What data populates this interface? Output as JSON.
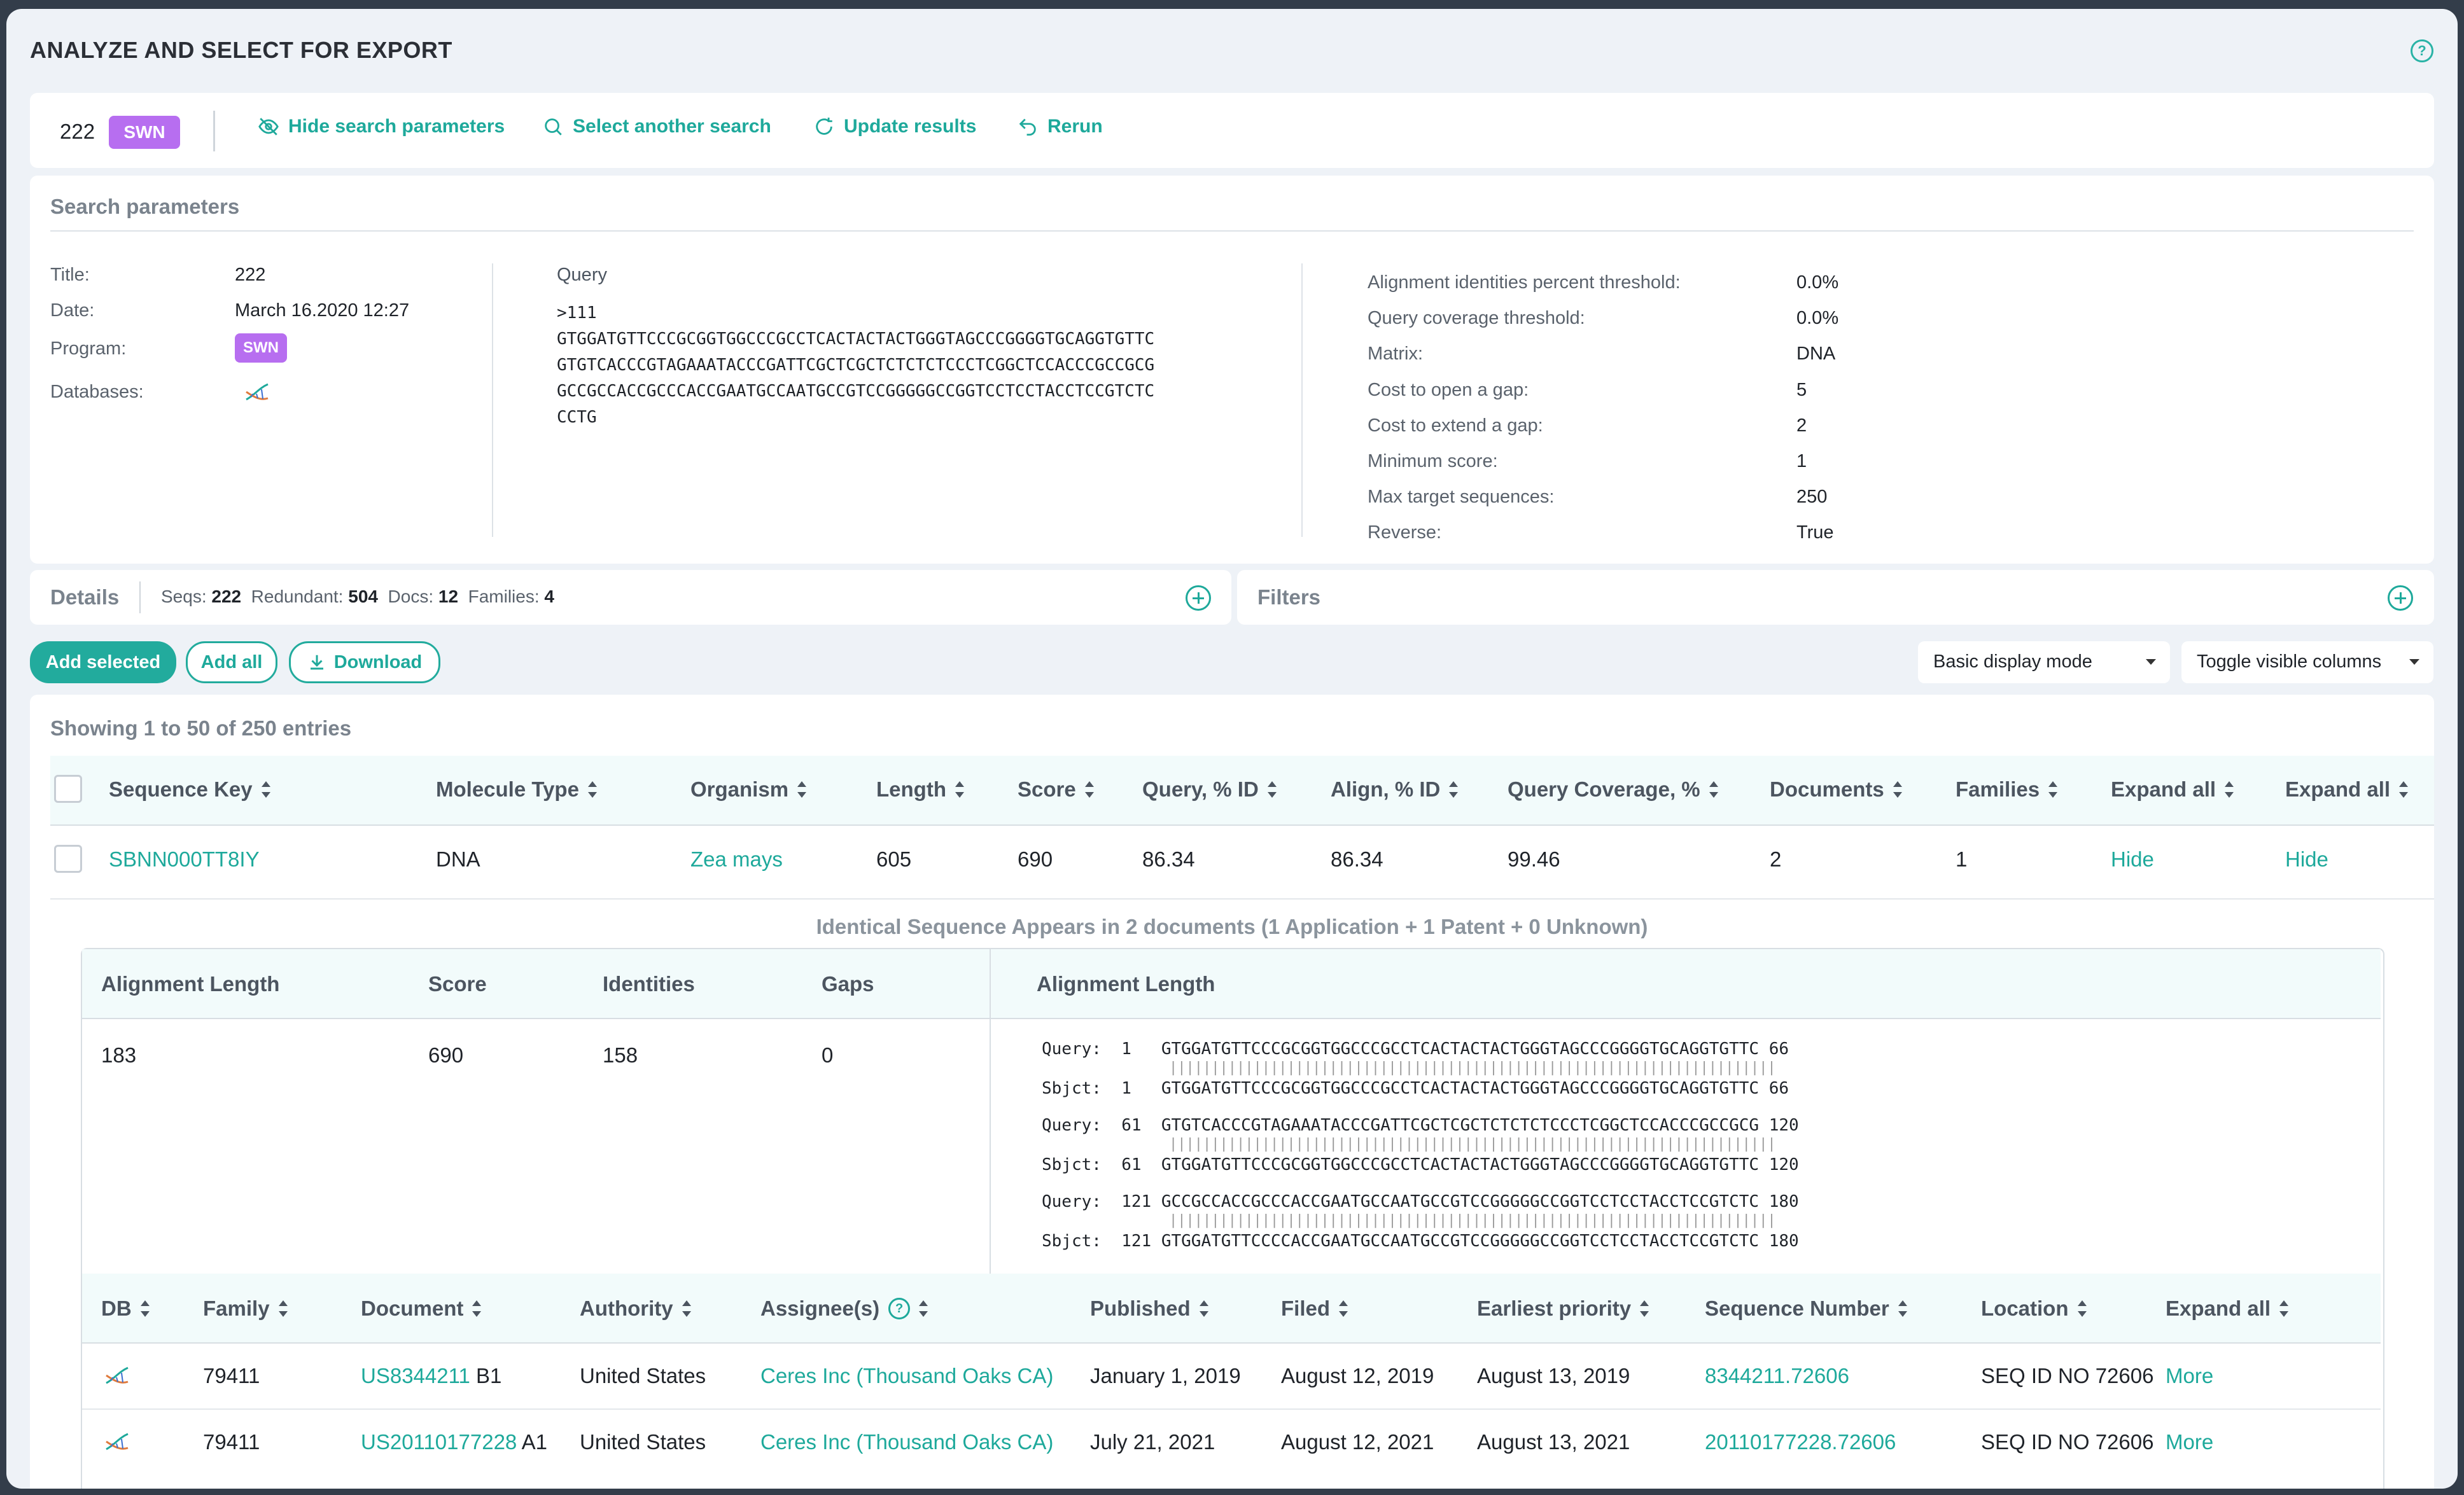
{
  "page": {
    "title": "ANALYZE AND SELECT FOR EXPORT"
  },
  "toolbar": {
    "search_id": "222",
    "program_badge": "SWN",
    "hide_params": "Hide search parameters",
    "select_another": "Select another search",
    "update_results": "Update results",
    "rerun": "Rerun"
  },
  "params": {
    "heading": "Search parameters",
    "title_label": "Title:",
    "title_value": "222",
    "date_label": "Date:",
    "date_value": "March 16.2020 12:27",
    "program_label": "Program:",
    "program_value": "SWN",
    "databases_label": "Databases:",
    "query_label": "Query",
    "query_lines": [
      ">111",
      "GTGGATGTTCCCGCGGTGGCCCGCCTCACTACTACTGGGTAGCCCGGGGTGCAGGTGTTC",
      "GTGTCACCCGTAGAAATACCCGATTCGCTCGCTCTCTCTCCCTCGGCTCCACCCGCCGCG",
      "GCCGCCACCGCCCACCGAATGCCAATGCCGTCCGGGGGCCGGTCCTCCTACCTCCGTCTC",
      "CCTG"
    ],
    "settings": [
      {
        "label": "Alignment identities percent threshold:",
        "value": "0.0%"
      },
      {
        "label": "Query coverage threshold:",
        "value": "0.0%"
      },
      {
        "label": "Matrix:",
        "value": "DNA"
      },
      {
        "label": "Cost to open a gap:",
        "value": "5"
      },
      {
        "label": "Cost to extend a gap:",
        "value": "2"
      },
      {
        "label": "Minimum score:",
        "value": "1"
      },
      {
        "label": "Max target sequences:",
        "value": "250"
      },
      {
        "label": "Reverse:",
        "value": "True"
      }
    ]
  },
  "details": {
    "heading": "Details",
    "seqs_label": "Seqs:",
    "seqs_value": "222",
    "redundant_label": "Redundant:",
    "redundant_value": "504",
    "docs_label": "Docs:",
    "docs_value": "12",
    "families_label": "Families:",
    "families_value": "4"
  },
  "filters": {
    "heading": "Filters"
  },
  "actions": {
    "add_selected": "Add selected",
    "add_all": "Add all",
    "download": "Download",
    "display_mode": "Basic display mode",
    "toggle_columns": "Toggle visible columns"
  },
  "results": {
    "showing": "Showing 1 to 50 of 250 entries",
    "columns": [
      "Sequence Key",
      "Molecule Type",
      "Organism",
      "Length",
      "Score",
      "Query, % ID",
      "Align, % ID",
      "Query Coverage, %",
      "Documents",
      "Families",
      "Expand all",
      "Expand all"
    ],
    "row": {
      "sequence_key": "SBNN000TT8IY",
      "molecule_type": "DNA",
      "organism": "Zea mays",
      "length": "605",
      "score": "690",
      "query_id": "86.34",
      "align_id": "86.34",
      "coverage": "99.46",
      "documents": "2",
      "families": "1",
      "expand1": "Hide",
      "expand2": "Hide"
    }
  },
  "detail_panel": {
    "caption": "Identical Sequence Appears in 2 documents (1 Application + 1 Patent + 0 Unknown)",
    "align_columns": [
      "Alignment Length",
      "Score",
      "Identities",
      "Gaps",
      "Alignment Length"
    ],
    "align_values": {
      "length": "183",
      "score": "690",
      "identities": "158",
      "gaps": "0"
    },
    "alignment": [
      {
        "q": "Query:  1   GTGGATGTTCCCGCGGTGGCCCGCCTCACTACTACTGGGTAGCCCGGGGTGCAGGTGTTC 66",
        "s": "Sbjct:  1   GTGGATGTTCCCGCGGTGGCCCGCCTCACTACTACTGGGTAGCCCGGGGTGCAGGTGTTC 66"
      },
      {
        "q": "Query:  61  GTGTCACCCGTAGAAATACCCGATTCGCTCGCTCTCTCTCCCTCGGCTCCACCCGCCGCG 120",
        "s": "Sbjct:  61  GTGGATGTTCCCGCGGTGGCCCGCCTCACTACTACTGGGTAGCCCGGGGTGCAGGTGTTC 120"
      },
      {
        "q": "Query:  121 GCCGCCACCGCCCACCGAATGCCAATGCCGTCCGGGGGCCGGTCCTCCTACCTCCGTCTC 180",
        "s": "Sbjct:  121 GTGGATGTTCCCCACCGAATGCCAATGCCGTCCGGGGGCCGGTCCTCCTACCTCCGTCTC 180"
      }
    ],
    "doc_columns": [
      "DB",
      "Family",
      "Document",
      "Authority",
      "Assignee(s)",
      "Published",
      "Filed",
      "Earliest priority",
      "Sequence Number",
      "Location",
      "Expand all"
    ],
    "docs": [
      {
        "family": "79411",
        "doc": "US8344211",
        "kind": "B1",
        "authority": "United States",
        "assignee": "Ceres Inc (Thousand Oaks CA)",
        "published": "January 1, 2019",
        "filed": "August 12, 2019",
        "priority": "August 13, 2019",
        "seqnum": "8344211.72606",
        "location": "SEQ ID NO 72606",
        "more": "More"
      },
      {
        "family": "79411",
        "doc": "US20110177228",
        "kind": "A1",
        "authority": "United States",
        "assignee": "Ceres Inc (Thousand Oaks CA)",
        "published": "July 21, 2021",
        "filed": "August 12, 2021",
        "priority": "August 13, 2021",
        "seqnum": "20110177228.72606",
        "location": "SEQ ID NO 72606",
        "more": "More"
      }
    ]
  },
  "colors": {
    "accent": "#1ea99b",
    "badge": "#b76ef0",
    "background": "#eef2f7",
    "frame": "#333d4a"
  }
}
